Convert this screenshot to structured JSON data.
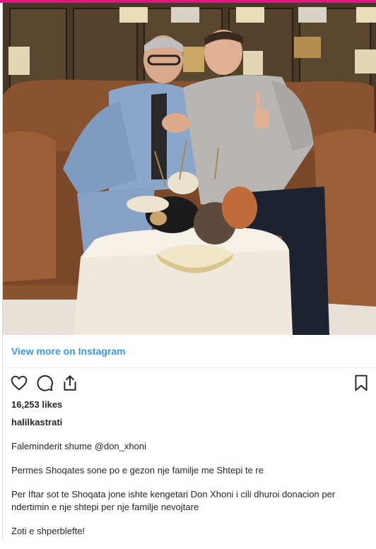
{
  "photo": {
    "alt": "Photo",
    "colors": {
      "wall": "#3a2c1f",
      "sofa": "#8a5330",
      "floor": "#e8e2da",
      "table": "#efe8dc"
    }
  },
  "embed": {
    "view_more_label": "View more on Instagram",
    "link_color": "#3897f0"
  },
  "actions": {
    "icons": [
      "heart-icon",
      "comment-icon",
      "share-icon",
      "bookmark-icon"
    ]
  },
  "post": {
    "likes": "16,253 likes",
    "username": "halilkastrati",
    "caption_lines": [
      "Faleminderit shume @don_xhoni",
      "Permes Shoqates sone po e gezon nje familje me Shtepi te re",
      "Per Iftar sot te Shoqata jone ishte kengetari Don Xhoni i cili dhuroi donacion per ndertimin e nje shtepi per nje familje nevojtare",
      "Zoti e shperblefte!"
    ]
  },
  "theme": {
    "accent_strip": "#e8117f",
    "text": "#262626",
    "divider": "#efefef"
  }
}
